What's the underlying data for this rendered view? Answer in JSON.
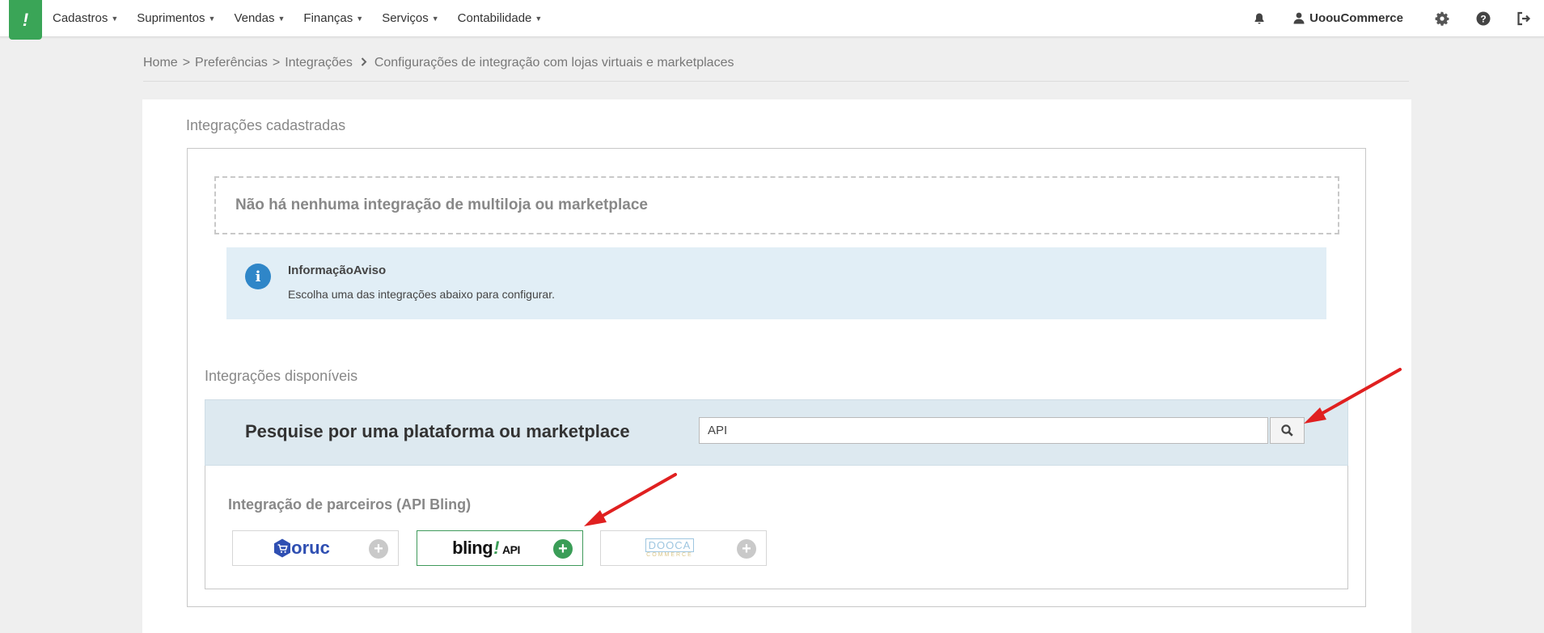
{
  "nav": {
    "logo_glyph": "!",
    "items": [
      {
        "label": "Cadastros"
      },
      {
        "label": "Suprimentos"
      },
      {
        "label": "Vendas"
      },
      {
        "label": "Finanças"
      },
      {
        "label": "Serviços"
      },
      {
        "label": "Contabilidade"
      }
    ],
    "user_name": "UoouCommerce"
  },
  "breadcrumb": {
    "home": "Home",
    "sep": ">",
    "preferencias": "Preferências",
    "integracoes": "Integrações",
    "current": "Configurações de integração com lojas virtuais e marketplaces"
  },
  "registered": {
    "title": "Integrações cadastradas",
    "empty_message": "Não há nenhuma integração de multiloja ou marketplace"
  },
  "info": {
    "title": "InformaçãoAviso",
    "text": "Escolha uma das integrações abaixo para configurar."
  },
  "available": {
    "title": "Integrações disponíveis",
    "search_label": "Pesquise por uma plataforma ou marketplace",
    "search_value": "API"
  },
  "partners": {
    "title": "Integração de parceiros (API Bling)",
    "tiles": [
      {
        "logo_text": "oruc",
        "selected": false
      },
      {
        "logo_text": "bling",
        "logo_bang": "!",
        "logo_suffix": "API",
        "selected": true
      },
      {
        "logo_text": "DOOCA",
        "logo_sub": "COMMERCE",
        "selected": false
      }
    ],
    "add_glyph": "+"
  },
  "colors": {
    "brand_green": "#3aa557",
    "info_blue": "#2f86c8",
    "search_band": "#dde9f0",
    "annotation_red": "#e02020"
  }
}
